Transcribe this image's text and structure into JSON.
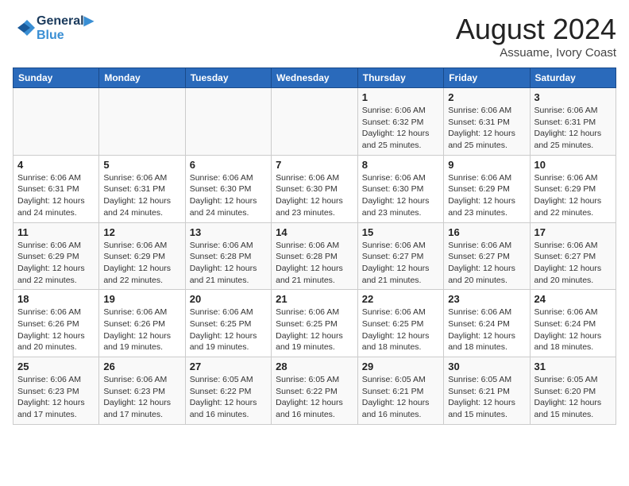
{
  "header": {
    "logo_line1": "General",
    "logo_line2": "Blue",
    "month": "August 2024",
    "location": "Assuame, Ivory Coast"
  },
  "days_of_week": [
    "Sunday",
    "Monday",
    "Tuesday",
    "Wednesday",
    "Thursday",
    "Friday",
    "Saturday"
  ],
  "weeks": [
    [
      {
        "day": "",
        "detail": ""
      },
      {
        "day": "",
        "detail": ""
      },
      {
        "day": "",
        "detail": ""
      },
      {
        "day": "",
        "detail": ""
      },
      {
        "day": "1",
        "detail": "Sunrise: 6:06 AM\nSunset: 6:32 PM\nDaylight: 12 hours\nand 25 minutes."
      },
      {
        "day": "2",
        "detail": "Sunrise: 6:06 AM\nSunset: 6:31 PM\nDaylight: 12 hours\nand 25 minutes."
      },
      {
        "day": "3",
        "detail": "Sunrise: 6:06 AM\nSunset: 6:31 PM\nDaylight: 12 hours\nand 25 minutes."
      }
    ],
    [
      {
        "day": "4",
        "detail": "Sunrise: 6:06 AM\nSunset: 6:31 PM\nDaylight: 12 hours\nand 24 minutes."
      },
      {
        "day": "5",
        "detail": "Sunrise: 6:06 AM\nSunset: 6:31 PM\nDaylight: 12 hours\nand 24 minutes."
      },
      {
        "day": "6",
        "detail": "Sunrise: 6:06 AM\nSunset: 6:30 PM\nDaylight: 12 hours\nand 24 minutes."
      },
      {
        "day": "7",
        "detail": "Sunrise: 6:06 AM\nSunset: 6:30 PM\nDaylight: 12 hours\nand 23 minutes."
      },
      {
        "day": "8",
        "detail": "Sunrise: 6:06 AM\nSunset: 6:30 PM\nDaylight: 12 hours\nand 23 minutes."
      },
      {
        "day": "9",
        "detail": "Sunrise: 6:06 AM\nSunset: 6:29 PM\nDaylight: 12 hours\nand 23 minutes."
      },
      {
        "day": "10",
        "detail": "Sunrise: 6:06 AM\nSunset: 6:29 PM\nDaylight: 12 hours\nand 22 minutes."
      }
    ],
    [
      {
        "day": "11",
        "detail": "Sunrise: 6:06 AM\nSunset: 6:29 PM\nDaylight: 12 hours\nand 22 minutes."
      },
      {
        "day": "12",
        "detail": "Sunrise: 6:06 AM\nSunset: 6:29 PM\nDaylight: 12 hours\nand 22 minutes."
      },
      {
        "day": "13",
        "detail": "Sunrise: 6:06 AM\nSunset: 6:28 PM\nDaylight: 12 hours\nand 21 minutes."
      },
      {
        "day": "14",
        "detail": "Sunrise: 6:06 AM\nSunset: 6:28 PM\nDaylight: 12 hours\nand 21 minutes."
      },
      {
        "day": "15",
        "detail": "Sunrise: 6:06 AM\nSunset: 6:27 PM\nDaylight: 12 hours\nand 21 minutes."
      },
      {
        "day": "16",
        "detail": "Sunrise: 6:06 AM\nSunset: 6:27 PM\nDaylight: 12 hours\nand 20 minutes."
      },
      {
        "day": "17",
        "detail": "Sunrise: 6:06 AM\nSunset: 6:27 PM\nDaylight: 12 hours\nand 20 minutes."
      }
    ],
    [
      {
        "day": "18",
        "detail": "Sunrise: 6:06 AM\nSunset: 6:26 PM\nDaylight: 12 hours\nand 20 minutes."
      },
      {
        "day": "19",
        "detail": "Sunrise: 6:06 AM\nSunset: 6:26 PM\nDaylight: 12 hours\nand 19 minutes."
      },
      {
        "day": "20",
        "detail": "Sunrise: 6:06 AM\nSunset: 6:25 PM\nDaylight: 12 hours\nand 19 minutes."
      },
      {
        "day": "21",
        "detail": "Sunrise: 6:06 AM\nSunset: 6:25 PM\nDaylight: 12 hours\nand 19 minutes."
      },
      {
        "day": "22",
        "detail": "Sunrise: 6:06 AM\nSunset: 6:25 PM\nDaylight: 12 hours\nand 18 minutes."
      },
      {
        "day": "23",
        "detail": "Sunrise: 6:06 AM\nSunset: 6:24 PM\nDaylight: 12 hours\nand 18 minutes."
      },
      {
        "day": "24",
        "detail": "Sunrise: 6:06 AM\nSunset: 6:24 PM\nDaylight: 12 hours\nand 18 minutes."
      }
    ],
    [
      {
        "day": "25",
        "detail": "Sunrise: 6:06 AM\nSunset: 6:23 PM\nDaylight: 12 hours\nand 17 minutes."
      },
      {
        "day": "26",
        "detail": "Sunrise: 6:06 AM\nSunset: 6:23 PM\nDaylight: 12 hours\nand 17 minutes."
      },
      {
        "day": "27",
        "detail": "Sunrise: 6:05 AM\nSunset: 6:22 PM\nDaylight: 12 hours\nand 16 minutes."
      },
      {
        "day": "28",
        "detail": "Sunrise: 6:05 AM\nSunset: 6:22 PM\nDaylight: 12 hours\nand 16 minutes."
      },
      {
        "day": "29",
        "detail": "Sunrise: 6:05 AM\nSunset: 6:21 PM\nDaylight: 12 hours\nand 16 minutes."
      },
      {
        "day": "30",
        "detail": "Sunrise: 6:05 AM\nSunset: 6:21 PM\nDaylight: 12 hours\nand 15 minutes."
      },
      {
        "day": "31",
        "detail": "Sunrise: 6:05 AM\nSunset: 6:20 PM\nDaylight: 12 hours\nand 15 minutes."
      }
    ]
  ]
}
